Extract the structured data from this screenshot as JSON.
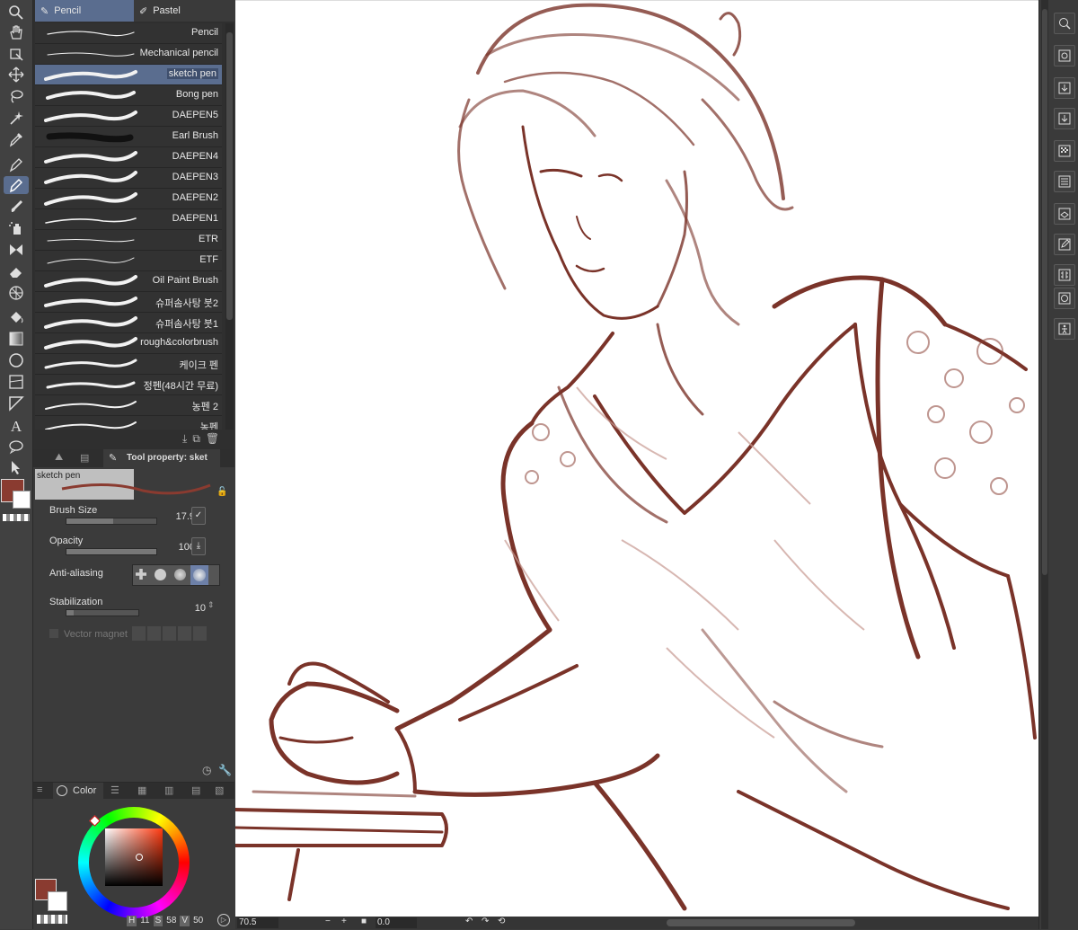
{
  "tabs": {
    "pencil": "Pencil",
    "pastel": "Pastel"
  },
  "brushes": [
    {
      "label": "Pencil"
    },
    {
      "label": "Mechanical pencil"
    },
    {
      "label": "sketch pen",
      "selected": true
    },
    {
      "label": "Bong pen"
    },
    {
      "label": "DAEPEN5"
    },
    {
      "label": "Earl Brush"
    },
    {
      "label": "DAEPEN4"
    },
    {
      "label": "DAEPEN3"
    },
    {
      "label": "DAEPEN2"
    },
    {
      "label": "DAEPEN1"
    },
    {
      "label": "ETR"
    },
    {
      "label": "ETF"
    },
    {
      "label": "Oil Paint Brush"
    },
    {
      "label": "슈퍼솜사탕 붓2"
    },
    {
      "label": "슈퍼솜사탕 붓1"
    },
    {
      "label": "rough&colorbrush"
    },
    {
      "label": "케이크 펜"
    },
    {
      "label": "정펜(48시간 무료)"
    },
    {
      "label": "농펜 2"
    },
    {
      "label": "농펜"
    }
  ],
  "property": {
    "tab_label": "Tool property: sket",
    "preview_label": "sketch pen",
    "brush_size_label": "Brush Size",
    "brush_size_value": "17.9",
    "opacity_label": "Opacity",
    "opacity_value": "100",
    "anti_aliasing_label": "Anti-aliasing",
    "stabilization_label": "Stabilization",
    "stabilization_value": "10",
    "vector_magnet_label": "Vector magnet"
  },
  "color_panel": {
    "tab_label": "Color",
    "main_color": "#8a3b30",
    "values": {
      "h": "11",
      "s": "58",
      "v": "50"
    },
    "h_label": "H",
    "s_label": "S",
    "v_label": "V"
  },
  "status": {
    "zoom": "70.5",
    "angle": "0.0"
  },
  "colors": {
    "stroke": "#7a3329",
    "accent": "#5a6d8f"
  }
}
